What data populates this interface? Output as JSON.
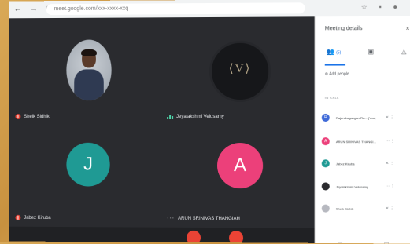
{
  "browser": {
    "url": "meet.google.com/xxx-xxxx-xxq",
    "nav_icons": "← → C",
    "ext_icons": "☆ ▪ ●"
  },
  "participants_grid": [
    {
      "name": "Sheik Sidhik",
      "kind": "photo"
    },
    {
      "name": "Jeyalakshmi Velusamy",
      "kind": "logo",
      "logo_text": "⟨V⟩"
    },
    {
      "name": "Jabez Kiruba",
      "kind": "initial",
      "initial": "J",
      "color": "#1f9a94"
    },
    {
      "name": "ARUN SRINIVAS THANGIAH",
      "kind": "initial",
      "initial": "A",
      "color": "#ec407a"
    }
  ],
  "panel": {
    "title": "Meeting details",
    "close_glyph": "×",
    "tab_people_label": "(5)",
    "tab_people_icon": "👥",
    "tab_chat_icon": "▣",
    "tab_activities_icon": "△",
    "add_people": "Add people",
    "add_people_icon": "⊕",
    "section_label": "IN CALL",
    "people": [
      {
        "name": "Rajendragangan Ra... (You)",
        "initial": "R",
        "color": "#3f6ad8",
        "icons": "✕ ⋮"
      },
      {
        "name": "ARUN SRINIVAS THANGI...",
        "initial": "A",
        "color": "#ec407a",
        "icons": "··· ⋮"
      },
      {
        "name": "Jabez Kiruba",
        "initial": "J",
        "color": "#1f9a94",
        "icons": "✕ ⋮"
      },
      {
        "name": "Jeyalakshmi Velusamy",
        "initial": "",
        "color": "#2b2b2e",
        "icons": "··· ⋮"
      },
      {
        "name": "Sheik Sidhik",
        "initial": "",
        "color": "#b7b9c0",
        "icons": "✕ ⋮"
      }
    ]
  },
  "colors": {
    "accent": "#1a73e8",
    "mic_off": "#ea4335"
  }
}
